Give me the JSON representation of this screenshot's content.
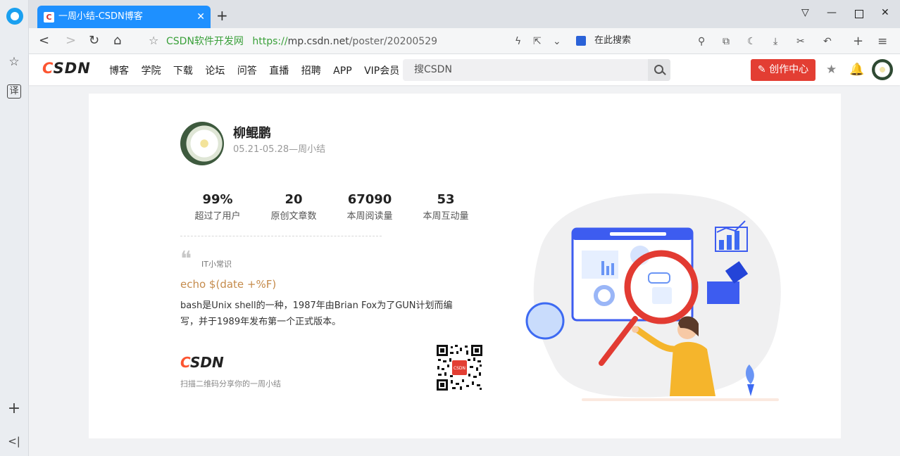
{
  "browser": {
    "tab_title": "一周小结-CSDN博客",
    "tab_favicon": "C",
    "new_tab": "+",
    "url_site": "CSDN软件开发网",
    "url_scheme": "https://",
    "url_host": "mp.csdn.net",
    "url_path": "/poster/20200529",
    "search_placeholder": "在此搜索",
    "side_translate": "译"
  },
  "header": {
    "logo_c": "C",
    "logo_rest": "SDN",
    "nav": [
      "博客",
      "学院",
      "下载",
      "论坛",
      "问答",
      "直播",
      "招聘",
      "APP",
      "VIP会员"
    ],
    "search_placeholder": "搜CSDN",
    "create_label": "创作中心"
  },
  "poster": {
    "name": "柳鲲鹏",
    "period": "05.21-05.28—周小结",
    "stats": [
      {
        "value": "99%",
        "label": "超过了用户"
      },
      {
        "value": "20",
        "label": "原创文章数"
      },
      {
        "value": "67090",
        "label": "本周阅读量"
      },
      {
        "value": "53",
        "label": "本周互动量"
      }
    ],
    "it_label": "IT小常识",
    "command": "echo $(date +%F)",
    "desc_line1": "bash是Unix shell的一种，1987年由Brian Fox为了GUN计划而编",
    "desc_line2": "写，并于1989年发布第一个正式版本。",
    "footer_logo_c": "C",
    "footer_logo_rest": "SDN",
    "scan_text": "扫描二维码分享你的一周小结",
    "qr_badge": "CSDN"
  },
  "colors": {
    "tab_blue": "#1e90ff",
    "csdn_red": "#fc5531",
    "create_red": "#e33e33",
    "command_color": "#c58b4c"
  }
}
